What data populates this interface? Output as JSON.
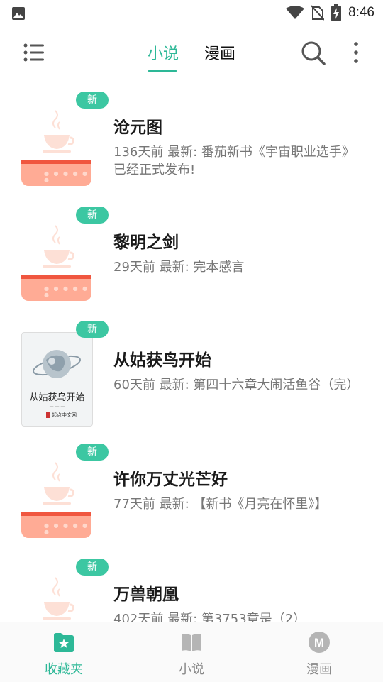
{
  "status_bar": {
    "time": "8:46",
    "icons": [
      "image-icon",
      "wifi-icon",
      "no-sim-icon",
      "battery-charging-icon"
    ]
  },
  "top_bar": {
    "menu_icon": "list-menu-icon",
    "tabs": [
      {
        "label": "小说",
        "active": true
      },
      {
        "label": "漫画",
        "active": false
      }
    ],
    "search_icon": "search-icon",
    "more_icon": "more-vertical-icon"
  },
  "books": [
    {
      "badge": "新",
      "title": "沧元图",
      "desc": "136天前 最新: 番茄新书《宇宙职业选手》已经正式发布!",
      "cover": "placeholder"
    },
    {
      "badge": "新",
      "title": "黎明之剑",
      "desc": "29天前 最新: 完本感言",
      "cover": "placeholder"
    },
    {
      "badge": "新",
      "title": "从姑获鸟开始",
      "desc": "60天前 最新: 第四十六章大闹活鱼谷（完）",
      "cover": "image",
      "cover_text": {
        "title": "从姑获鸟开始",
        "publisher": "起点中文网"
      }
    },
    {
      "badge": "新",
      "title": "许你万丈光芒好",
      "desc": "77天前 最新: 【新书《月亮在怀里》】",
      "cover": "placeholder"
    },
    {
      "badge": "新",
      "title": "万兽朝凰",
      "desc": "402天前 最新: 第3753章是（2）",
      "cover": "placeholder"
    }
  ],
  "bottom_nav": [
    {
      "label": "收藏夹",
      "icon": "folder-star-icon",
      "active": true
    },
    {
      "label": "小说",
      "icon": "book-icon",
      "active": false
    },
    {
      "label": "漫画",
      "icon": "manga-m-icon",
      "active": false
    }
  ],
  "colors": {
    "accent": "#2db897",
    "badge": "#3cc7a2",
    "placeholder_box": "#ffab95",
    "placeholder_stripe": "#f0563f",
    "placeholder_cup": "#fde0d6"
  }
}
